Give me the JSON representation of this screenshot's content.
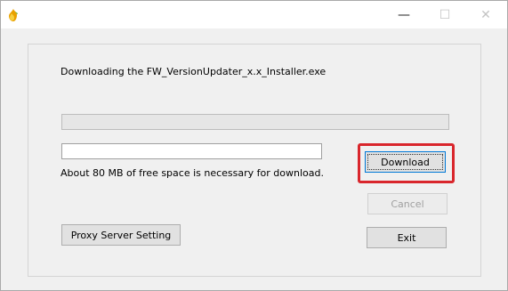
{
  "window": {
    "icon": "app-flame-icon",
    "controls": {
      "minimize_glyph": "—",
      "maximize_glyph": "☐",
      "close_glyph": "✕"
    }
  },
  "main": {
    "message": "Downloading the FW_VersionUpdater_x.x_Installer.exe",
    "free_space_note": "About 80 MB of free space is necessary for download.",
    "progress_total": 0,
    "progress_file": 0
  },
  "buttons": {
    "download": "Download",
    "cancel": "Cancel",
    "exit": "Exit",
    "proxy": "Proxy Server Setting"
  },
  "colors": {
    "highlight": "#d9262c",
    "progress_fill": "#06b025"
  }
}
